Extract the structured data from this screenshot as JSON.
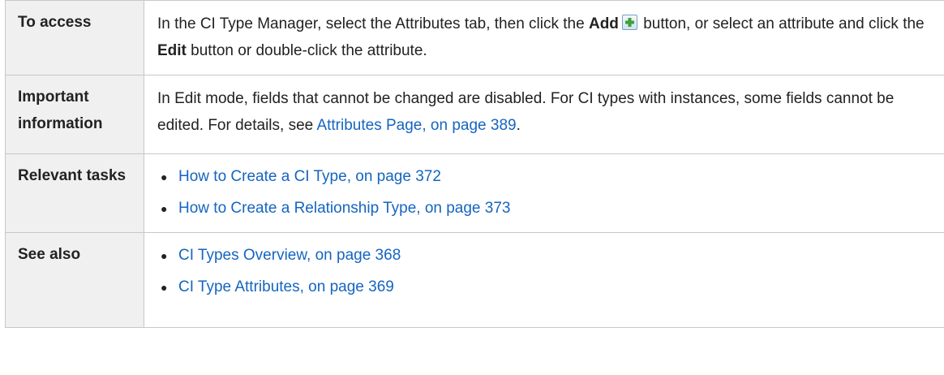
{
  "rows": {
    "access": {
      "label": "To access",
      "text_1": "In the CI Type Manager, select the Attributes tab, then click the",
      "bold_add": "Add",
      "add_icon": "add-plus-icon",
      "text_2": "button, or select an attribute and click the",
      "bold_edit": "Edit",
      "text_3": "button or double-click the attribute."
    },
    "important": {
      "label": "Important information",
      "text_1": "In Edit mode, fields that cannot be changed are disabled. For CI types with instances, some fields cannot be edited. For details, see",
      "link": "Attributes Page, on page 389",
      "text_2": "."
    },
    "tasks": {
      "label": "Relevant tasks",
      "items": [
        "How to Create a CI Type, on page 372",
        "How to Create a Relationship Type, on page 373"
      ]
    },
    "see_also": {
      "label": "See also",
      "items": [
        "CI Types Overview, on page 368",
        "CI Type Attributes, on page 369"
      ]
    }
  },
  "colors": {
    "link": "#1565c0",
    "label_bg": "#f0f0f0",
    "border": "#c8c8c8",
    "icon_plus": "#3aa23a"
  }
}
